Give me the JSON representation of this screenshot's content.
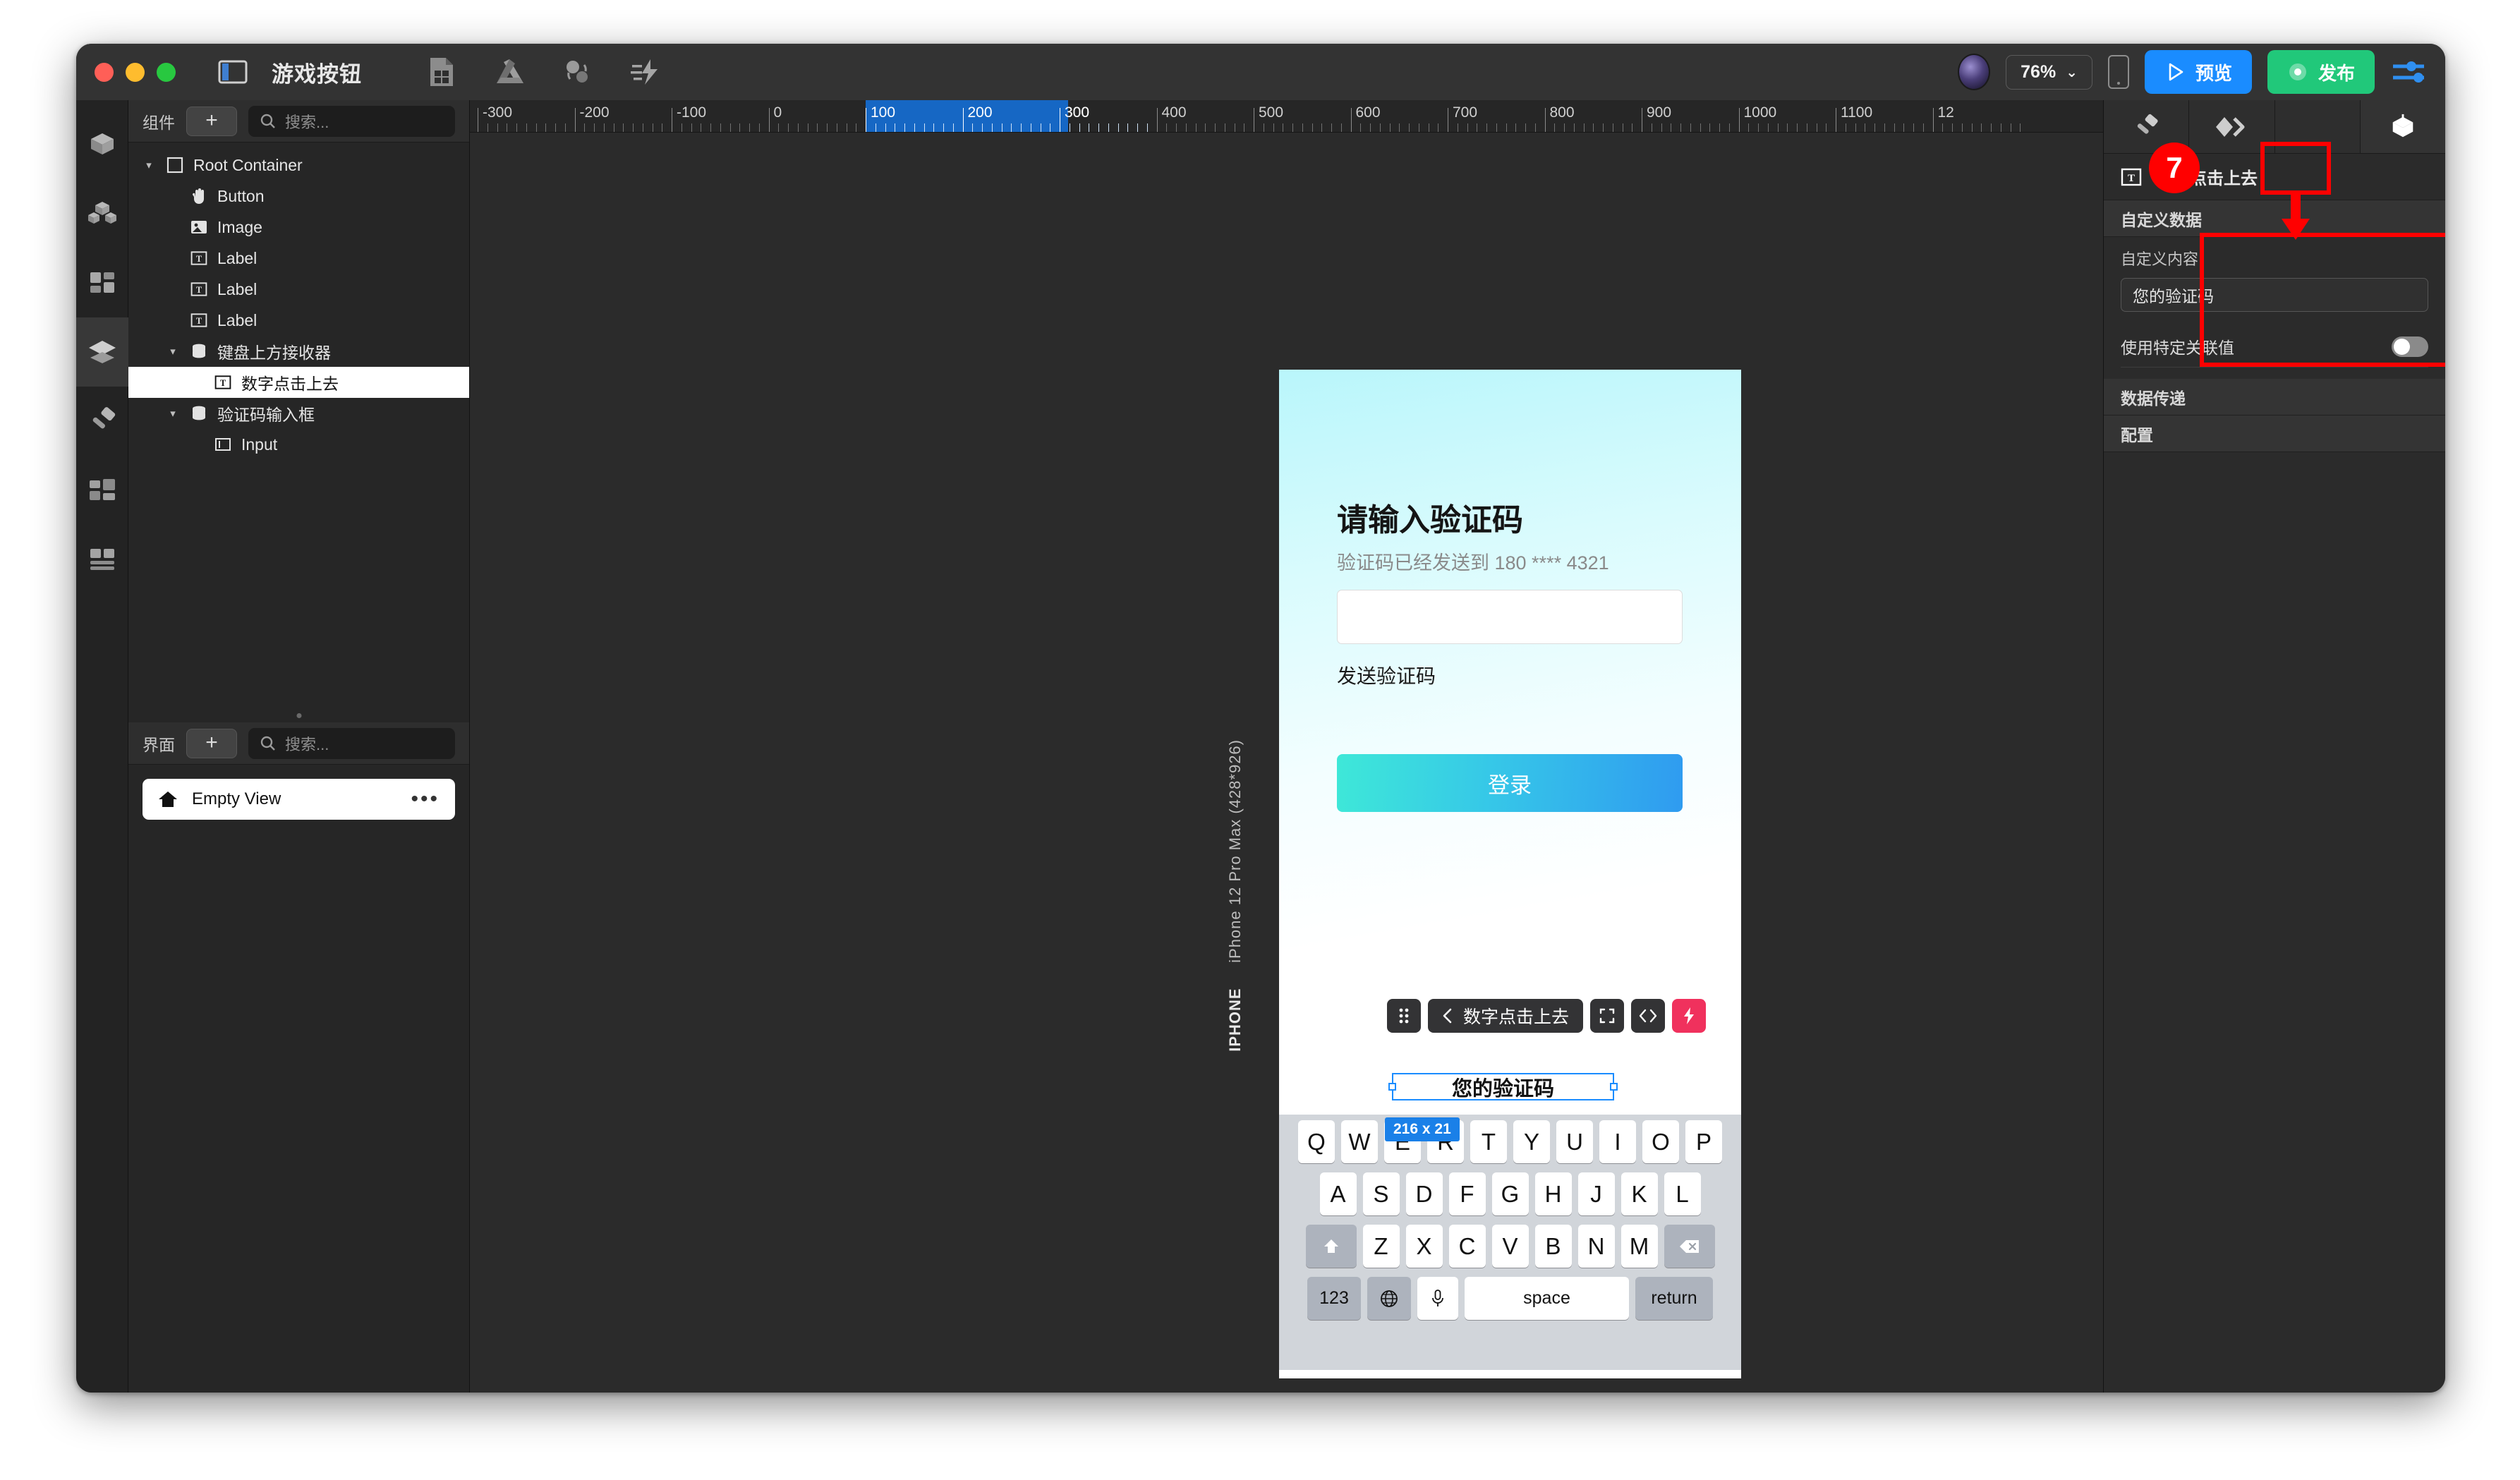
{
  "window": {
    "title": "游戏按钮",
    "traffic_lights": [
      "close",
      "minimize",
      "maximize"
    ],
    "sidebar_toggle_icon": "sidebar-toggle-icon",
    "toolbar_icons": [
      "spreadsheet-icon",
      "drive-triangle-icon",
      "sync-icon",
      "lightning-flow-icon"
    ],
    "zoom_level": "76%",
    "chevron": "⌄",
    "preview_label": "预览",
    "publish_label": "发布",
    "settings_icon": "sliders-icon",
    "device_icon": "phone-icon",
    "avatar": "user-avatar"
  },
  "rail": {
    "items": [
      {
        "name": "component-cube-icon",
        "active": false
      },
      {
        "name": "components-group-icon",
        "active": false
      },
      {
        "name": "grid-blocks-icon",
        "active": false
      },
      {
        "name": "layers-icon",
        "active": true
      },
      {
        "name": "brush-icon",
        "active": false
      },
      {
        "name": "layout-panels-icon",
        "active": false
      },
      {
        "name": "stack-rows-icon",
        "active": false
      }
    ]
  },
  "components_panel": {
    "title": "组件",
    "add_label": "+",
    "search_placeholder": "搜索...",
    "tree": [
      {
        "label": "Root Container",
        "depth": 0,
        "twisty": "▾",
        "icon": "container-icon",
        "selected": false
      },
      {
        "label": "Button",
        "depth": 1,
        "twisty": "",
        "icon": "hand-pointer-icon",
        "selected": false
      },
      {
        "label": "Image",
        "depth": 1,
        "twisty": "",
        "icon": "image-icon",
        "selected": false
      },
      {
        "label": "Label",
        "depth": 1,
        "twisty": "",
        "icon": "text-icon",
        "selected": false
      },
      {
        "label": "Label",
        "depth": 1,
        "twisty": "",
        "icon": "text-icon",
        "selected": false
      },
      {
        "label": "Label",
        "depth": 1,
        "twisty": "",
        "icon": "text-icon",
        "selected": false
      },
      {
        "label": "键盘上方接收器",
        "depth": 1,
        "twisty": "▾",
        "icon": "database-icon",
        "selected": false
      },
      {
        "label": "数字点击上去",
        "depth": 2,
        "twisty": "",
        "icon": "text-icon",
        "selected": true
      },
      {
        "label": "验证码输入框",
        "depth": 1,
        "twisty": "▾",
        "icon": "database-icon",
        "selected": false
      },
      {
        "label": "Input",
        "depth": 2,
        "twisty": "",
        "icon": "input-icon",
        "selected": false
      }
    ]
  },
  "screens_panel": {
    "title": "界面",
    "add_label": "+",
    "search_placeholder": "搜索...",
    "items": [
      {
        "label": "Empty View",
        "icon": "home-icon",
        "more": "•••"
      }
    ]
  },
  "canvas": {
    "ruler_labels": [
      "-300",
      "-200",
      "-100",
      "0",
      "100",
      "200",
      "300",
      "400",
      "500",
      "600",
      "700",
      "800",
      "900",
      "1000",
      "1100",
      "12"
    ],
    "ruler_selection": {
      "from": "100",
      "to": "300"
    },
    "device_label_prefix": "IPHONE",
    "device_label": "iPhone 12 Pro Max (428*926)",
    "size_badge": "216 x 21"
  },
  "phone_preview": {
    "title": "请输入验证码",
    "subtitle": "验证码已经发送到 180 **** 4321",
    "code_input_value": "",
    "send_code_label": "发送验证码",
    "login_label": "登录",
    "selected_text": "您的验证码"
  },
  "float_toolbar": {
    "grip_icon": "drag-grip-icon",
    "back_icon": "chevron-left-icon",
    "element_label": "数字点击上去",
    "fullscreen_icon": "expand-icon",
    "code_icon": "code-brackets-icon",
    "bolt_icon": "lightning-bolt-icon"
  },
  "keyboard": {
    "row1": [
      "Q",
      "W",
      "E",
      "R",
      "T",
      "Y",
      "U",
      "I",
      "O",
      "P"
    ],
    "row2": [
      "A",
      "S",
      "D",
      "F",
      "G",
      "H",
      "J",
      "K",
      "L"
    ],
    "row3_letters": [
      "Z",
      "X",
      "C",
      "V",
      "B",
      "N",
      "M"
    ],
    "shift_icon": "shift-arrow-icon",
    "backspace_icon": "backspace-icon",
    "numbers_label": "123",
    "globe_icon": "globe-icon",
    "mic_icon": "microphone-icon",
    "space_label": "space",
    "return_label": "return"
  },
  "inspector": {
    "tabs": [
      {
        "name": "brush-tab",
        "icon": "brush-icon",
        "active": false
      },
      {
        "name": "layers-tab",
        "icon": "diamond-stack-icon",
        "active": false
      },
      {
        "name": "events-tab",
        "icon": "",
        "active": false
      },
      {
        "name": "data-tab",
        "icon": "cube-box-icon",
        "active": true
      }
    ],
    "element_icon": "text-icon",
    "element_name": "数字点击上去",
    "sections": [
      {
        "title": "自定义数据",
        "fields": [
          {
            "label": "自定义内容",
            "value": "您的验证码"
          }
        ]
      },
      {
        "title": "数据传递"
      },
      {
        "title": "配置"
      }
    ],
    "toggle_row": {
      "label": "使用特定关联值",
      "value": "off"
    }
  },
  "annotations": {
    "step_number": "7",
    "highlight_color": "#ff0000"
  }
}
